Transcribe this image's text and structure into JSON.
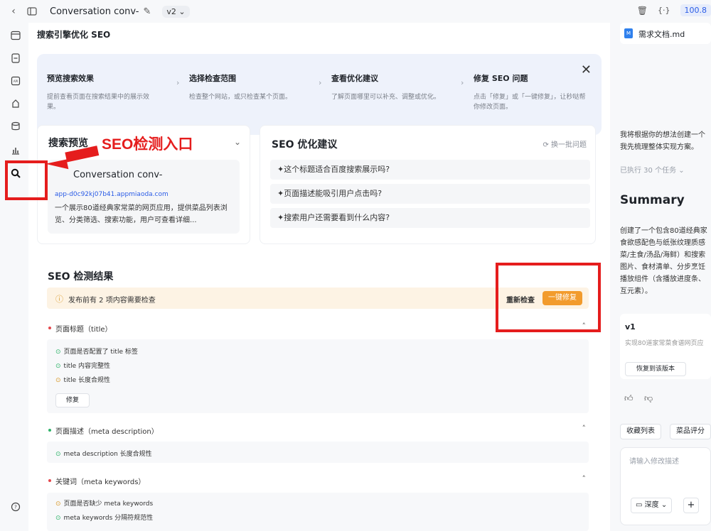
{
  "topbar": {
    "title": "Conversation conv-",
    "version": "v2",
    "badge": "100.8"
  },
  "main": {
    "title": "搜索引擎优化 SEO",
    "steps": [
      {
        "title": "预览搜索效果",
        "desc1": "提前查看页面在搜索结果中的展示效",
        "desc2": "果。"
      },
      {
        "title": "选择检查范围",
        "desc1": "检查整个网站，或只检查某个页面。",
        "desc2": ""
      },
      {
        "title": "查看优化建议",
        "desc1": "了解页面哪里可以补充、调整或优化。",
        "desc2": ""
      },
      {
        "title": "修复 SEO 问题",
        "desc1": "点击「修复」或「一键修复」，让秒哒帮",
        "desc2": "你修改页面。"
      }
    ],
    "preview": {
      "title": "搜索预览",
      "site": "Conversation conv-",
      "url": "app-d0c92kj07b41.appmiaoda.com",
      "desc": "一个展示80道经典家常菜的网页应用，提供菜品列表浏览、分类筛选、搜索功能，用户可查看详细..."
    },
    "suggest": {
      "title": "SEO 优化建议",
      "refresh": "换一批问题",
      "questions": [
        "这个标题适合百度搜索展示吗?",
        "页面描述能吸引用户点击吗?",
        "搜索用户还需要看到什么内容?"
      ]
    },
    "results": {
      "title": "SEO 检测结果",
      "warning": "发布前有 2 项内容需要检查",
      "recheck": "重新检查",
      "fix_all": "一键修复",
      "sections": [
        {
          "title": "页面标题（title）",
          "items": [
            "页面是否配置了 title 标签",
            "title 内容完整性",
            "title 长度合规性"
          ],
          "fix": "修复"
        },
        {
          "title": "页面描述（meta description）",
          "items": [
            "meta description 长度合规性"
          ]
        },
        {
          "title": "关键词（meta keywords）",
          "items": [
            "页面是否缺少 meta keywords",
            "meta keywords 分隔符规范性"
          ]
        }
      ]
    },
    "annotation": "SEO检测入口"
  },
  "right": {
    "doc": "需求文档.md",
    "doc_badge": "M",
    "intro": [
      "我将根据你的想法创建一个",
      "我先梳理整体实现方案。"
    ],
    "executed": "已执行 30 个任务",
    "summary_title": "Summary",
    "summary": [
      "创建了一个包含80道经典家",
      "食欲感配色与纸张纹理质感",
      "菜/主食/汤品/海鲜）和搜索",
      "图片、食材清单、分步烹饪",
      "播放组件（含播放进度条、",
      "互元素）。"
    ],
    "v1": {
      "title": "v1",
      "desc": "实现80道家常菜食谱网页应",
      "restore": "恢复到该版本"
    },
    "tabs": [
      "收藏列表",
      "菜品评分"
    ],
    "input_placeholder": "请输入修改描述",
    "depth": "深度"
  }
}
